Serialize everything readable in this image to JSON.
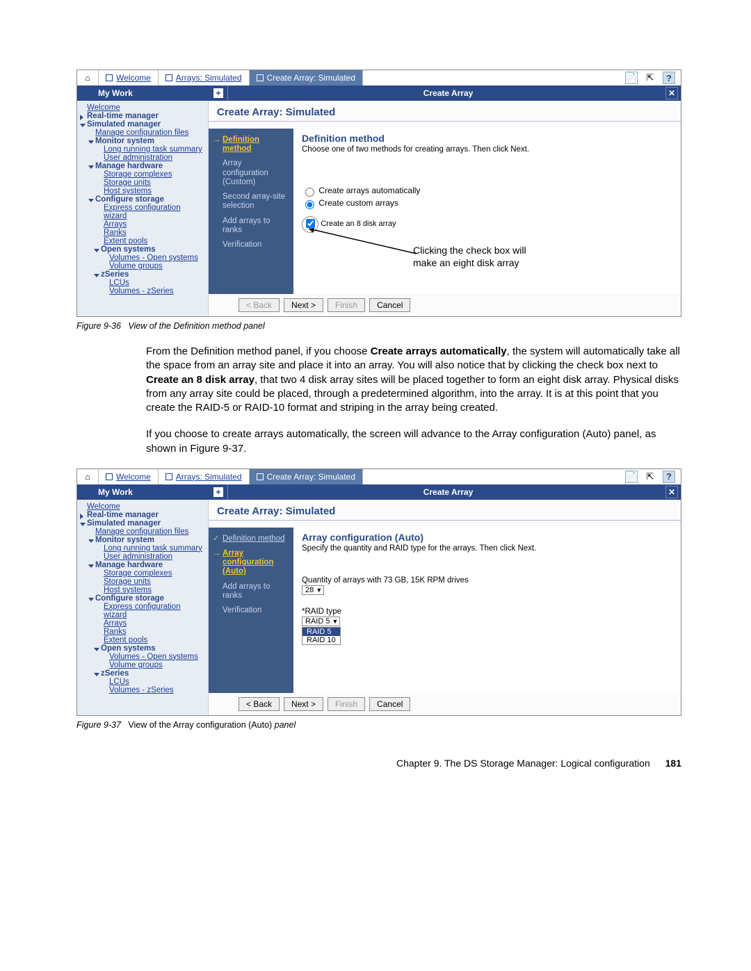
{
  "tabs": {
    "welcome": "Welcome",
    "arrays": "Arrays: Simulated",
    "create": "Create Array: Simulated"
  },
  "header": {
    "left": "My Work",
    "right": "Create Array"
  },
  "help_icon": "?",
  "sidebar": {
    "welcome": "Welcome",
    "rtm": "Real-time manager",
    "sim": "Simulated manager",
    "mcf": "Manage configuration files",
    "monitor": "Monitor system",
    "lrts": "Long running task summary",
    "ua": "User administration",
    "mhw": "Manage hardware",
    "sc": "Storage complexes",
    "su": "Storage units",
    "hs": "Host systems",
    "cs": "Configure storage",
    "ecw": "Express configuration wizard",
    "arrays": "Arrays",
    "ranks": "Ranks",
    "ep": "Extent pools",
    "os": "Open systems",
    "vos": "Volumes - Open systems",
    "vg": "Volume groups",
    "zs": "zSeries",
    "lcus": "LCUs",
    "vz": "Volumes - zSeries"
  },
  "fig1": {
    "pane_title": "Create Array: Simulated",
    "steps": {
      "def": "Definition method",
      "acc": "Array configuration (Custom)",
      "sas": "Second array-site selection",
      "aar": "Add arrays to ranks",
      "ver": "Verification"
    },
    "h": "Definition method",
    "desc": "Choose one of two methods for creating arrays. Then click Next.",
    "r1": "Create arrays automatically",
    "r2": "Create custom arrays",
    "cb": "Create an 8 disk array",
    "ann1": "Clicking the check box will",
    "ann2": "make an eight disk array",
    "buttons": {
      "back": "< Back",
      "next": "Next >",
      "finish": "Finish",
      "cancel": "Cancel"
    },
    "caption_label": "Figure 9-36",
    "caption_text": "View of the Definition method panel"
  },
  "body1": "From the Definition method panel, if you choose ",
  "body1b": "Create arrays automatically",
  "body1c": ", the system will automatically take all the space from an array site and place it into an array. You will also notice that by clicking the check box next to ",
  "body1d": "Create an 8 disk array",
  "body1e": ", that two 4 disk array sites will be placed together to form an eight disk array. Physical disks from any array site could be placed, through a predetermined algorithm, into the array. It is at this point that you create the RAID-5 or RAID-10 format and striping in the array being created.",
  "body2": "If you choose to create arrays automatically, the screen will advance to the Array configuration (Auto) panel, as shown in Figure 9-37.",
  "fig2": {
    "pane_title": "Create Array: Simulated",
    "steps": {
      "def": "Definition method",
      "acc": "Array configuration (Auto)",
      "aar": "Add arrays to ranks",
      "ver": "Verification"
    },
    "h": "Array configuration (Auto)",
    "desc": "Specify the quantity and RAID type for the arrays. Then click Next.",
    "q_label": "Quantity of arrays with 73 GB, 15K RPM drives",
    "q_val": "28",
    "raid_label": "*RAID type",
    "raid_sel": "RAID 5",
    "raid_opts": [
      "RAID 5",
      "RAID 10"
    ],
    "buttons": {
      "back": "< Back",
      "next": "Next >",
      "finish": "Finish",
      "cancel": "Cancel"
    },
    "caption_label": "Figure 9-37",
    "caption_text": "View of the Array configuration (Auto) ",
    "caption_text_i": "panel"
  },
  "footer": {
    "chapter": "Chapter 9. The DS Storage Manager: Logical configuration",
    "page": "181"
  }
}
